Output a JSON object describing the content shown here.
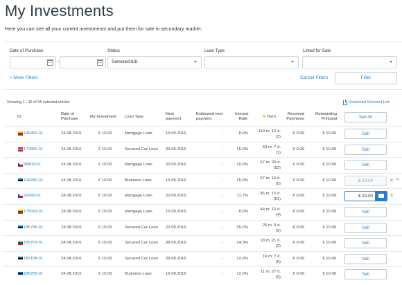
{
  "page": {
    "title": "My Investments",
    "intro": "Here you can see all your current investments and put them for sale in secondary market."
  },
  "filters": {
    "date_label": "Date of Purchase",
    "date_from": "",
    "date_to": "",
    "status_label": "Status",
    "status_value": "Selected:6/8",
    "loan_type_label": "Loan Type",
    "loan_type_value": "",
    "listed_label": "Listed for Sale",
    "listed_value": "",
    "more_filters": "+ More Filters",
    "cancel_filters": "Cancel Filters",
    "filter_button": "Filter"
  },
  "table": {
    "entries_text": "Showing 1 - 15 of 15 selected entries",
    "download_text": "Download Selected List",
    "sell_all": "Sell All",
    "headers": {
      "id": "ID",
      "date": [
        "Date of",
        "Purchase"
      ],
      "investment": "My Investment",
      "loan_type": "Loan Type",
      "next_payment": [
        "Next",
        "payment"
      ],
      "estimated": [
        "Estimated next",
        "payment"
      ],
      "interest": [
        "Interest",
        "Rate"
      ],
      "term": "Term",
      "received": [
        "Received",
        "Payments"
      ],
      "outstanding": [
        "Outstanding",
        "Principal"
      ]
    },
    "rows": [
      {
        "flag": "lt",
        "id": "146450-01",
        "date": "24.08.2016",
        "investment": "€ 10.00",
        "loan_type": "Mortgage Loan",
        "next_payment": "15.09.2016",
        "estimated": "-",
        "rate": "8.0%",
        "term1": "119 m. 12 d.",
        "term2": "(2)",
        "received": "€ 0.00",
        "outstanding": "€ 10.00",
        "sell": "Sell",
        "state": "normal"
      },
      {
        "flag": "lv",
        "id": "172860-01",
        "date": "24.08.2016",
        "investment": "€ 10.00",
        "loan_type": "Secured Car Loan",
        "next_payment": "06.09.2016",
        "estimated": "-",
        "rate": "15.0%",
        "term1": "59 m. 7 d.",
        "term2": "(1)",
        "received": "€ 0.00",
        "outstanding": "€ 10.00",
        "sell": "Sell",
        "state": "normal"
      },
      {
        "flag": "cz",
        "id": "68409-01",
        "date": "24.08.2016",
        "investment": "€ 10.00",
        "loan_type": "Mortgage Loan",
        "next_payment": "20.09.2016",
        "estimated": "-",
        "rate": "10.0%",
        "term1": "57 m. 20 d.",
        "term2": "(52)",
        "received": "€ 0.00",
        "outstanding": "€ 10.00",
        "sell": "Sell",
        "state": "normal"
      },
      {
        "flag": "ee",
        "id": "109280-01",
        "date": "24.08.2016",
        "investment": "€ 10.00",
        "loan_type": "Business Loan",
        "next_payment": "15.09.2016",
        "estimated": "-",
        "rate": "15.0%",
        "term1": "57 m. 15 d.",
        "term2": "(5)",
        "received": "€ 0.00",
        "outstanding": "€ 10.00",
        "sell": "€ 10.00",
        "state": "listed"
      },
      {
        "flag": "cz",
        "id": "91842-01",
        "date": "24.08.2016",
        "investment": "€ 10.00",
        "loan_type": "Mortgage Loan",
        "next_payment": "20.09.2016",
        "estimated": "-",
        "rate": "11.7%",
        "term1": "45 m. 15 d.",
        "term2": "(51)",
        "received": "€ 0.00",
        "outstanding": "€ 10.00",
        "sell": "€ 10.00",
        "state": "editing"
      },
      {
        "flag": "lt",
        "id": "175683-01",
        "date": "24.08.2016",
        "investment": "€ 10.00",
        "loan_type": "Mortgage Loan",
        "next_payment": "15.09.2016",
        "estimated": "-",
        "rate": "8.0%",
        "term1": "44 m. 10 d.",
        "term2": "(4)",
        "received": "€ 0.00",
        "outstanding": "€ 10.00",
        "sell": "Sell",
        "state": "normal"
      },
      {
        "flag": "ee",
        "id": "185785-01",
        "date": "24.08.2016",
        "investment": "€ 10.00",
        "loan_type": "Secured Car Loan",
        "next_payment": "22.09.2016",
        "estimated": "-",
        "rate": "15.0%",
        "term1": "26 m. 9 d.",
        "term2": "(5)",
        "received": "€ 0.00",
        "outstanding": "€ 10.00",
        "sell": "Sell",
        "state": "normal"
      },
      {
        "flag": "lt",
        "id": "185763-01",
        "date": "24.08.2016",
        "investment": "€ 10.00",
        "loan_type": "Secured Car Loan",
        "next_payment": "08.09.2016",
        "estimated": "-",
        "rate": "14.3%",
        "term1": "18 m. 21 d.",
        "term2": "(2)",
        "received": "€ 0.00",
        "outstanding": "€ 10.00",
        "sell": "Sell",
        "state": "normal"
      },
      {
        "flag": "ee",
        "id": "182158-01",
        "date": "24.08.2016",
        "investment": "€ 10.00",
        "loan_type": "Secured Car Loan",
        "next_payment": "26.08.2016",
        "estimated": "-",
        "rate": "12.0%",
        "term1": "16 m. 7 d.",
        "term2": "(0)",
        "received": "€ 0.00",
        "outstanding": "€ 10.00",
        "sell": "Sell",
        "state": "normal"
      },
      {
        "flag": "ee",
        "id": "186255-01",
        "date": "24.08.2016",
        "investment": "€ 10.00",
        "loan_type": "Business Loan",
        "next_payment": "16.09.2016",
        "estimated": "-",
        "rate": "12.0%",
        "term1": "11 m. 27 d.",
        "term2": "(0)",
        "received": "€ 0.00",
        "outstanding": "€ 10.00",
        "sell": "Sell",
        "state": "normal"
      }
    ]
  },
  "colors": {
    "accent": "#2d7dc6",
    "sort_arrow": "#e29b2b",
    "flags": {
      "lt": [
        "#fdb913",
        "#006a44",
        "#c1272d"
      ],
      "lv": [
        "#9e3039",
        "#ffffff",
        "#9e3039"
      ],
      "ee": [
        "#0072ce",
        "#000000",
        "#ffffff"
      ],
      "cz": [
        "#ffffff",
        "#d7141a",
        "#11457e"
      ]
    }
  }
}
